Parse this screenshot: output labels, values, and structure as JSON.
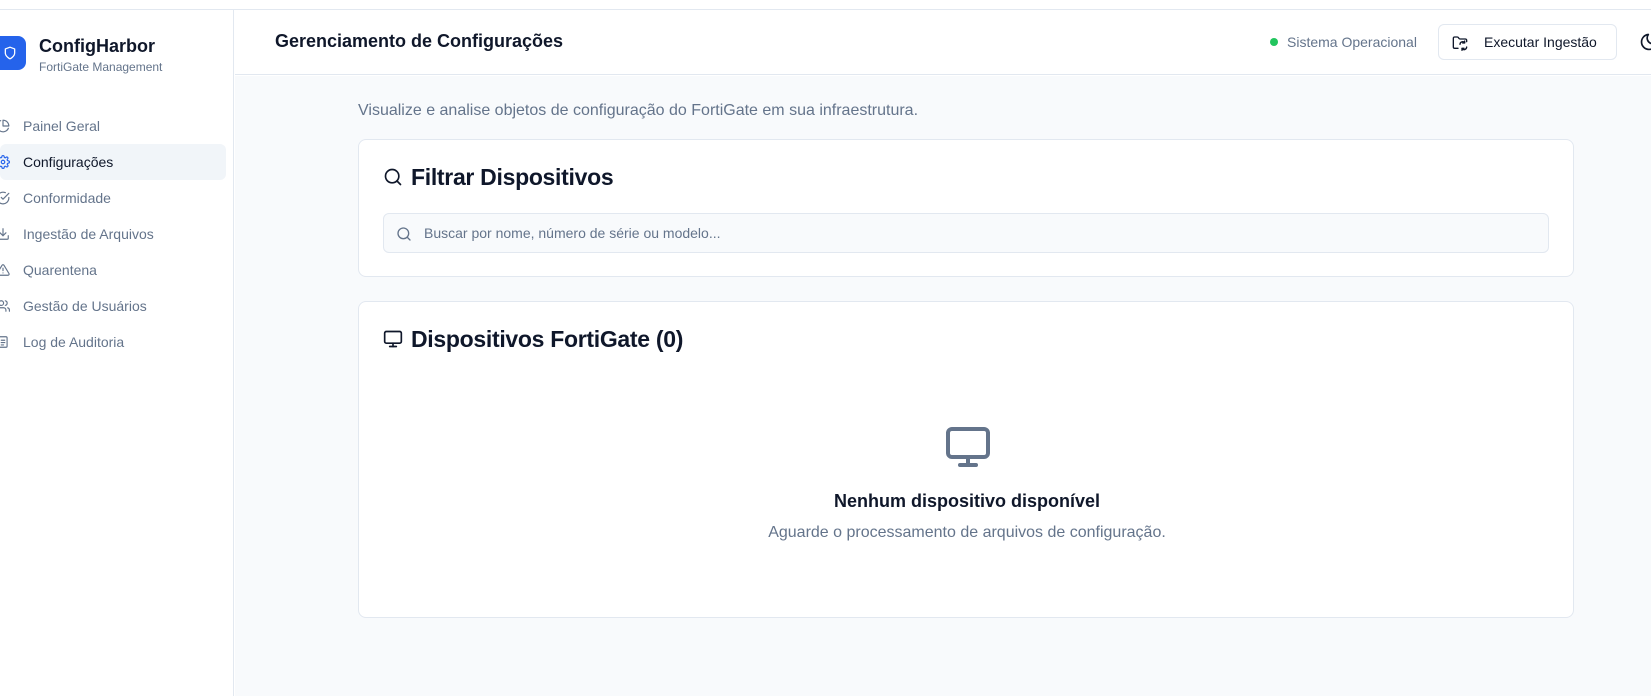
{
  "brand": {
    "name": "ConfigHarbor",
    "subtitle": "FortiGate Management"
  },
  "sidebar": {
    "items": [
      {
        "label": "Painel Geral",
        "icon": "pie-chart-icon",
        "active": false
      },
      {
        "label": "Configurações",
        "icon": "settings-icon",
        "active": true
      },
      {
        "label": "Conformidade",
        "icon": "check-circle-icon",
        "active": false
      },
      {
        "label": "Ingestão de Arquivos",
        "icon": "download-icon",
        "active": false
      },
      {
        "label": "Quarentena",
        "icon": "alert-triangle-icon",
        "active": false
      },
      {
        "label": "Gestão de Usuários",
        "icon": "users-icon",
        "active": false
      },
      {
        "label": "Log de Auditoria",
        "icon": "clipboard-icon",
        "active": false
      }
    ]
  },
  "header": {
    "title": "Gerenciamento de Configurações",
    "status_label": "Sistema Operacional",
    "run_button_label": "Executar Ingestão"
  },
  "main": {
    "subtitle": "Visualize e analise objetos de configuração do FortiGate em sua infraestrutura.",
    "filter": {
      "title": "Filtrar Dispositivos",
      "search_placeholder": "Buscar por nome, número de série ou modelo..."
    },
    "devices": {
      "title": "Dispositivos FortiGate (0)",
      "empty_title": "Nenhum dispositivo disponível",
      "empty_description": "Aguarde o processamento de arquivos de configuração."
    }
  },
  "colors": {
    "accent": "#2563eb",
    "status_ok": "#22c55e",
    "muted_text": "#64748b",
    "active_nav_bg": "#f1f5f9"
  }
}
